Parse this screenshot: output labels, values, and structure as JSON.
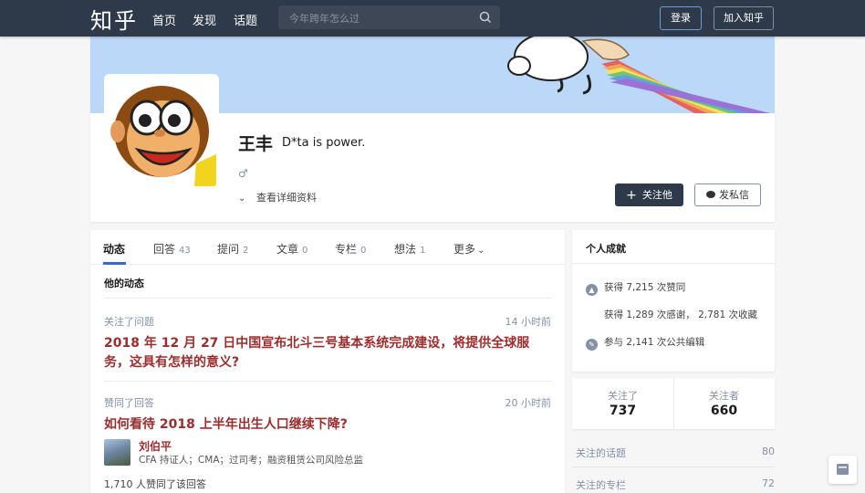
{
  "header": {
    "logo": "知乎",
    "nav": [
      "首页",
      "发现",
      "话题"
    ],
    "search_placeholder": "今年跨年怎么过",
    "login_label": "登录",
    "join_label": "加入知乎"
  },
  "profile": {
    "name": "王丰",
    "headline": "D*ta is power.",
    "gender_symbol": "♂",
    "details_label": "查看详细资料",
    "follow_label": "关注他",
    "message_label": "发私信"
  },
  "tabs": [
    {
      "label": "动态",
      "count": ""
    },
    {
      "label": "回答",
      "count": "43"
    },
    {
      "label": "提问",
      "count": "2"
    },
    {
      "label": "文章",
      "count": "0"
    },
    {
      "label": "专栏",
      "count": "0"
    },
    {
      "label": "想法",
      "count": "1"
    },
    {
      "label": "更多",
      "count": ""
    }
  ],
  "feed": {
    "section_title": "他的动态",
    "items": [
      {
        "action": "关注了问题",
        "time": "14 小时前",
        "title": "2018 年 12 月 27 日中国宣布北斗三号基本系统完成建设，将提供全球服务，这具有怎样的意义?"
      },
      {
        "action": "赞同了回答",
        "time": "20 小时前",
        "title": "如何看待 2018 上半年出生人口继续下降?",
        "author": "刘伯平",
        "author_bio": "CFA 持证人；CMA；过司考；融资租赁公司风险总监",
        "likes": "1,710 人赞同了该回答"
      }
    ]
  },
  "achievements": {
    "title": "个人成就",
    "likes": "获得 7,215 次赞同",
    "thanks": "获得 1,289 次感谢，  2,781 次收藏",
    "edits": "参与 2,141 次公共编辑"
  },
  "follow_counts": {
    "following_label": "关注了",
    "following": "737",
    "followers_label": "关注者",
    "followers": "660"
  },
  "links": [
    {
      "label": "关注的话题",
      "count": "80"
    },
    {
      "label": "关注的专栏",
      "count": "72"
    }
  ]
}
